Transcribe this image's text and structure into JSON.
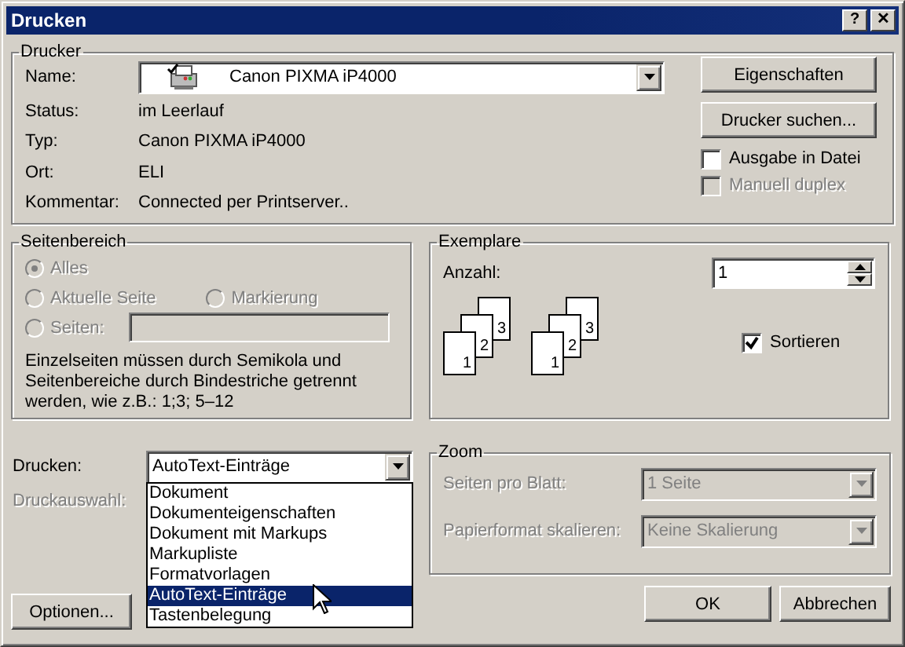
{
  "window": {
    "title": "Drucken",
    "help_button": "?",
    "close_button": "✕"
  },
  "printer": {
    "legend": "Drucker",
    "name_label": "Name:",
    "name_value": "Canon PIXMA iP4000",
    "info": [
      {
        "label": "Status:",
        "value": "im Leerlauf"
      },
      {
        "label": "Typ:",
        "value": "Canon PIXMA iP4000"
      },
      {
        "label": "Ort:",
        "value": "ELI"
      },
      {
        "label": "Kommentar:",
        "value": "Connected per Printserver.."
      }
    ],
    "buttons": [
      "Eigenschaften",
      "Drucker suchen..."
    ],
    "checkboxes": [
      {
        "label": "Ausgabe in Datei",
        "checked": false,
        "disabled": false
      },
      {
        "label": "Manuell duplex",
        "checked": false,
        "disabled": true
      }
    ]
  },
  "page_range": {
    "legend": "Seitenbereich",
    "options": [
      {
        "label": "Alles",
        "selected": true,
        "disabled": true
      },
      {
        "label": "Aktuelle Seite",
        "selected": false,
        "disabled": true
      },
      {
        "label": "Markierung",
        "selected": false,
        "disabled": true
      },
      {
        "label": "Seiten:",
        "selected": false,
        "disabled": true
      }
    ],
    "note": "Einzelseiten müssen durch Semikola und Seitenbereiche durch Bindestriche getrennt werden, wie z.B.: 1;3; 5–12"
  },
  "copies": {
    "legend": "Exemplare",
    "count_label": "Anzahl:",
    "count_value": "1",
    "stacks": [
      [
        "3",
        "2",
        "1"
      ],
      [
        "3",
        "2",
        "1"
      ]
    ],
    "collate": {
      "label": "Sortieren",
      "checked": true
    }
  },
  "print_what": {
    "label": "Drucken:",
    "value": "AutoText-Einträge",
    "expanded": true,
    "options": [
      {
        "label": "Dokument",
        "selected": false
      },
      {
        "label": "Dokumenteigenschaften",
        "selected": false
      },
      {
        "label": "Dokument mit Markups",
        "selected": false
      },
      {
        "label": "Markupliste",
        "selected": false
      },
      {
        "label": "Formatvorlagen",
        "selected": false
      },
      {
        "label": "AutoText-Einträge",
        "selected": true
      },
      {
        "label": "Tastenbelegung",
        "selected": false
      }
    ]
  },
  "print_selection": {
    "label": "Druckauswahl:",
    "disabled": true
  },
  "zoom": {
    "legend": "Zoom",
    "rows": [
      {
        "label": "Seiten pro Blatt:",
        "value": "1 Seite",
        "disabled": true
      },
      {
        "label": "Papierformat skalieren:",
        "value": "Keine Skalierung",
        "disabled": true
      }
    ]
  },
  "buttons": {
    "options": "Optionen...",
    "ok": "OK",
    "cancel": "Abbrechen"
  }
}
